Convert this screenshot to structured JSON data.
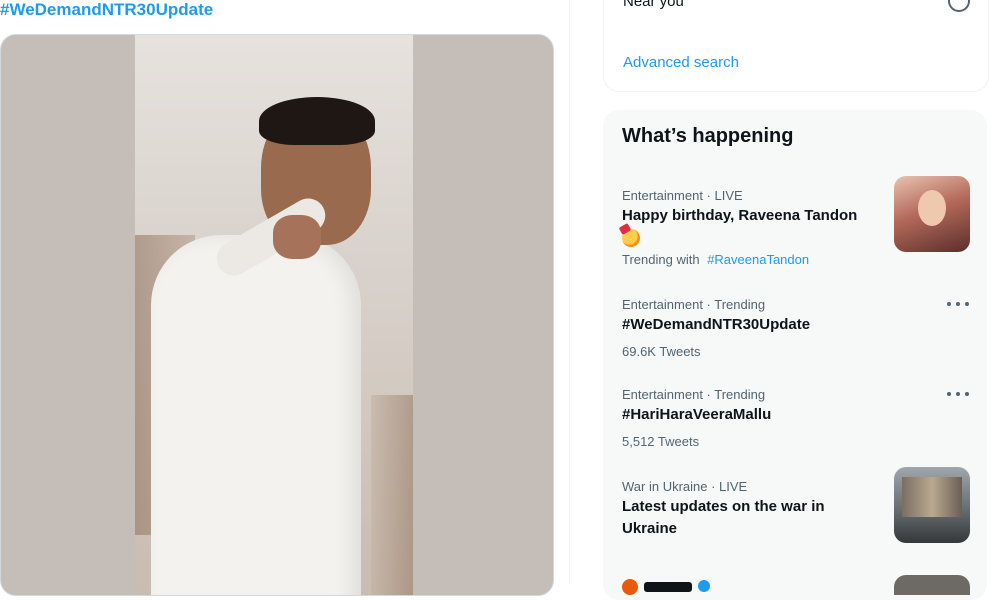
{
  "tweet": {
    "hashtag": "#WeDemandNTR30Update"
  },
  "filters": {
    "near_you_label": "Near you",
    "advanced_search_label": "Advanced search"
  },
  "trends": {
    "title": "What’s happening",
    "items": [
      {
        "meta": "Entertainment · LIVE",
        "name": "Happy birthday, Raveena Tandon",
        "emoji_icon": "party-face-icon",
        "sub_prefix": "Trending with",
        "sub_link": "#RaveenaTandon"
      },
      {
        "meta": "Entertainment · Trending",
        "name": "#WeDemandNTR30Update",
        "sub": "69.6K Tweets"
      },
      {
        "meta": "Entertainment · Trending",
        "name": "#HariHaraVeeraMallu",
        "sub": "5,512 Tweets"
      },
      {
        "meta": "War in Ukraine · LIVE",
        "name": "Latest updates on the war in Ukraine"
      }
    ]
  },
  "colors": {
    "accent": "#1d9bf0",
    "text_primary": "#0f1419",
    "text_secondary": "#536471",
    "card_bg": "#f7f9f9"
  }
}
